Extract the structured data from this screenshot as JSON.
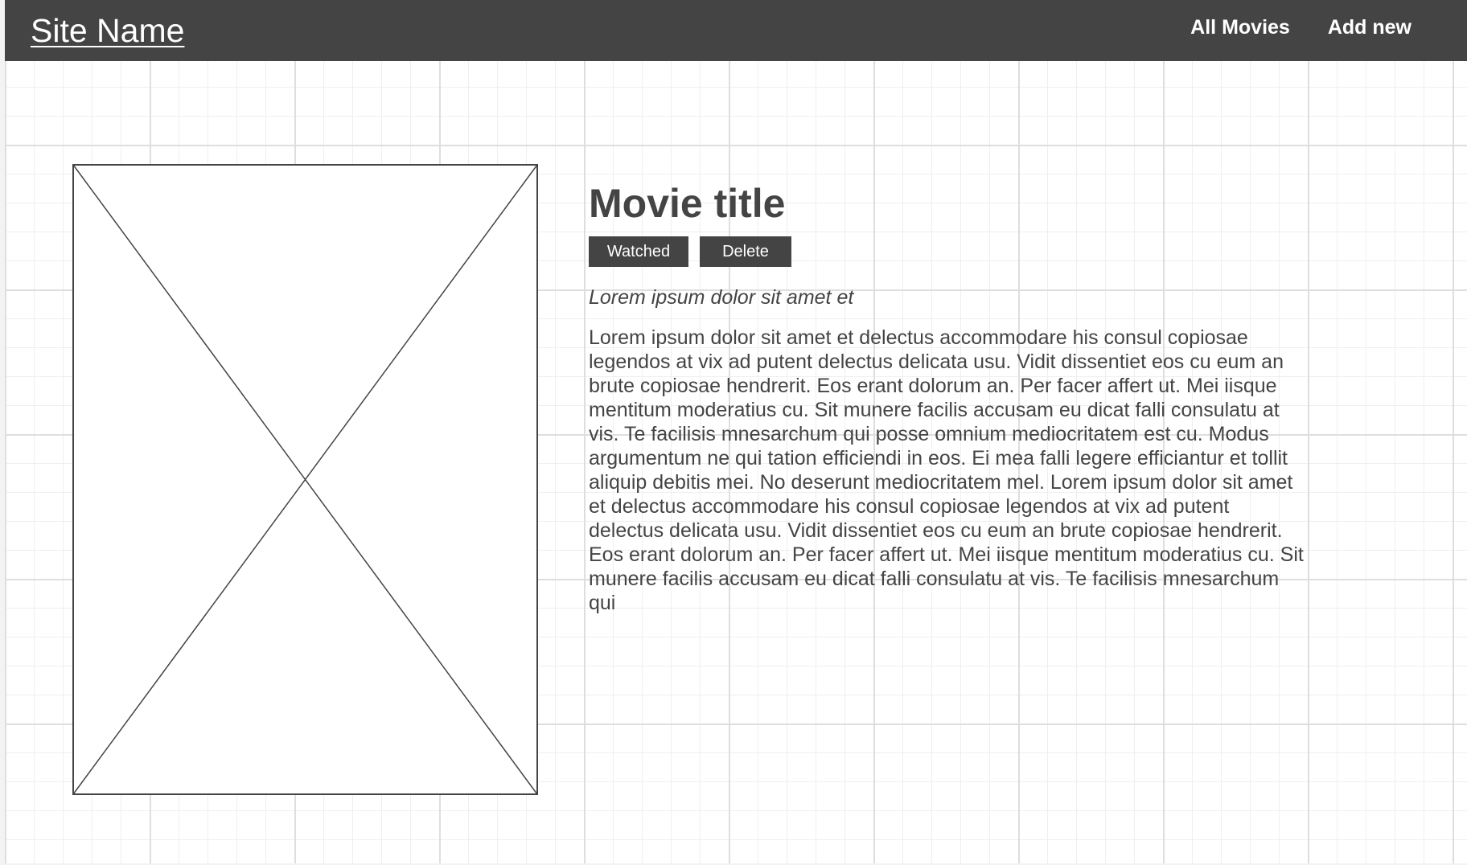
{
  "header": {
    "site_name": "Site Name",
    "nav": [
      {
        "label": "All Movies"
      },
      {
        "label": "Add new"
      }
    ]
  },
  "movie": {
    "poster_icon": "image-placeholder-icon",
    "title": "Movie title",
    "actions": {
      "watched_label": "Watched",
      "delete_label": "Delete"
    },
    "subtitle": "Lorem ipsum dolor sit amet et",
    "description": "Lorem ipsum dolor sit amet et delectus accommodare his consul copiosae legendos at vix ad putent delectus delicata usu. Vidit dissentiet eos cu eum an brute copiosae hendrerit. Eos erant dolorum an. Per facer affert ut. Mei iisque mentitum moderatius cu. Sit munere facilis accusam eu dicat falli consulatu at vis. Te facilisis mnesarchum qui posse omnium mediocritatem est cu. Modus argumentum ne qui tation efficiendi in eos. Ei mea falli legere efficiantur et tollit aliquip debitis mei. No deserunt mediocritatem mel. Lorem ipsum dolor sit amet et delectus accommodare his consul copiosae legendos at vix ad putent delectus delicata usu. Vidit dissentiet eos cu eum an brute copiosae hendrerit. Eos erant dolorum an. Per facer affert ut. Mei iisque mentitum moderatius cu. Sit munere facilis accusam eu dicat falli consulatu at vis. Te facilisis mnesarchum qui"
  },
  "colors": {
    "navbar_bg": "#444444",
    "text": "#444444",
    "button_bg": "#444444",
    "button_text": "#ffffff",
    "grid_line": "#e6e6e6",
    "page_bg": "#ffffff"
  }
}
